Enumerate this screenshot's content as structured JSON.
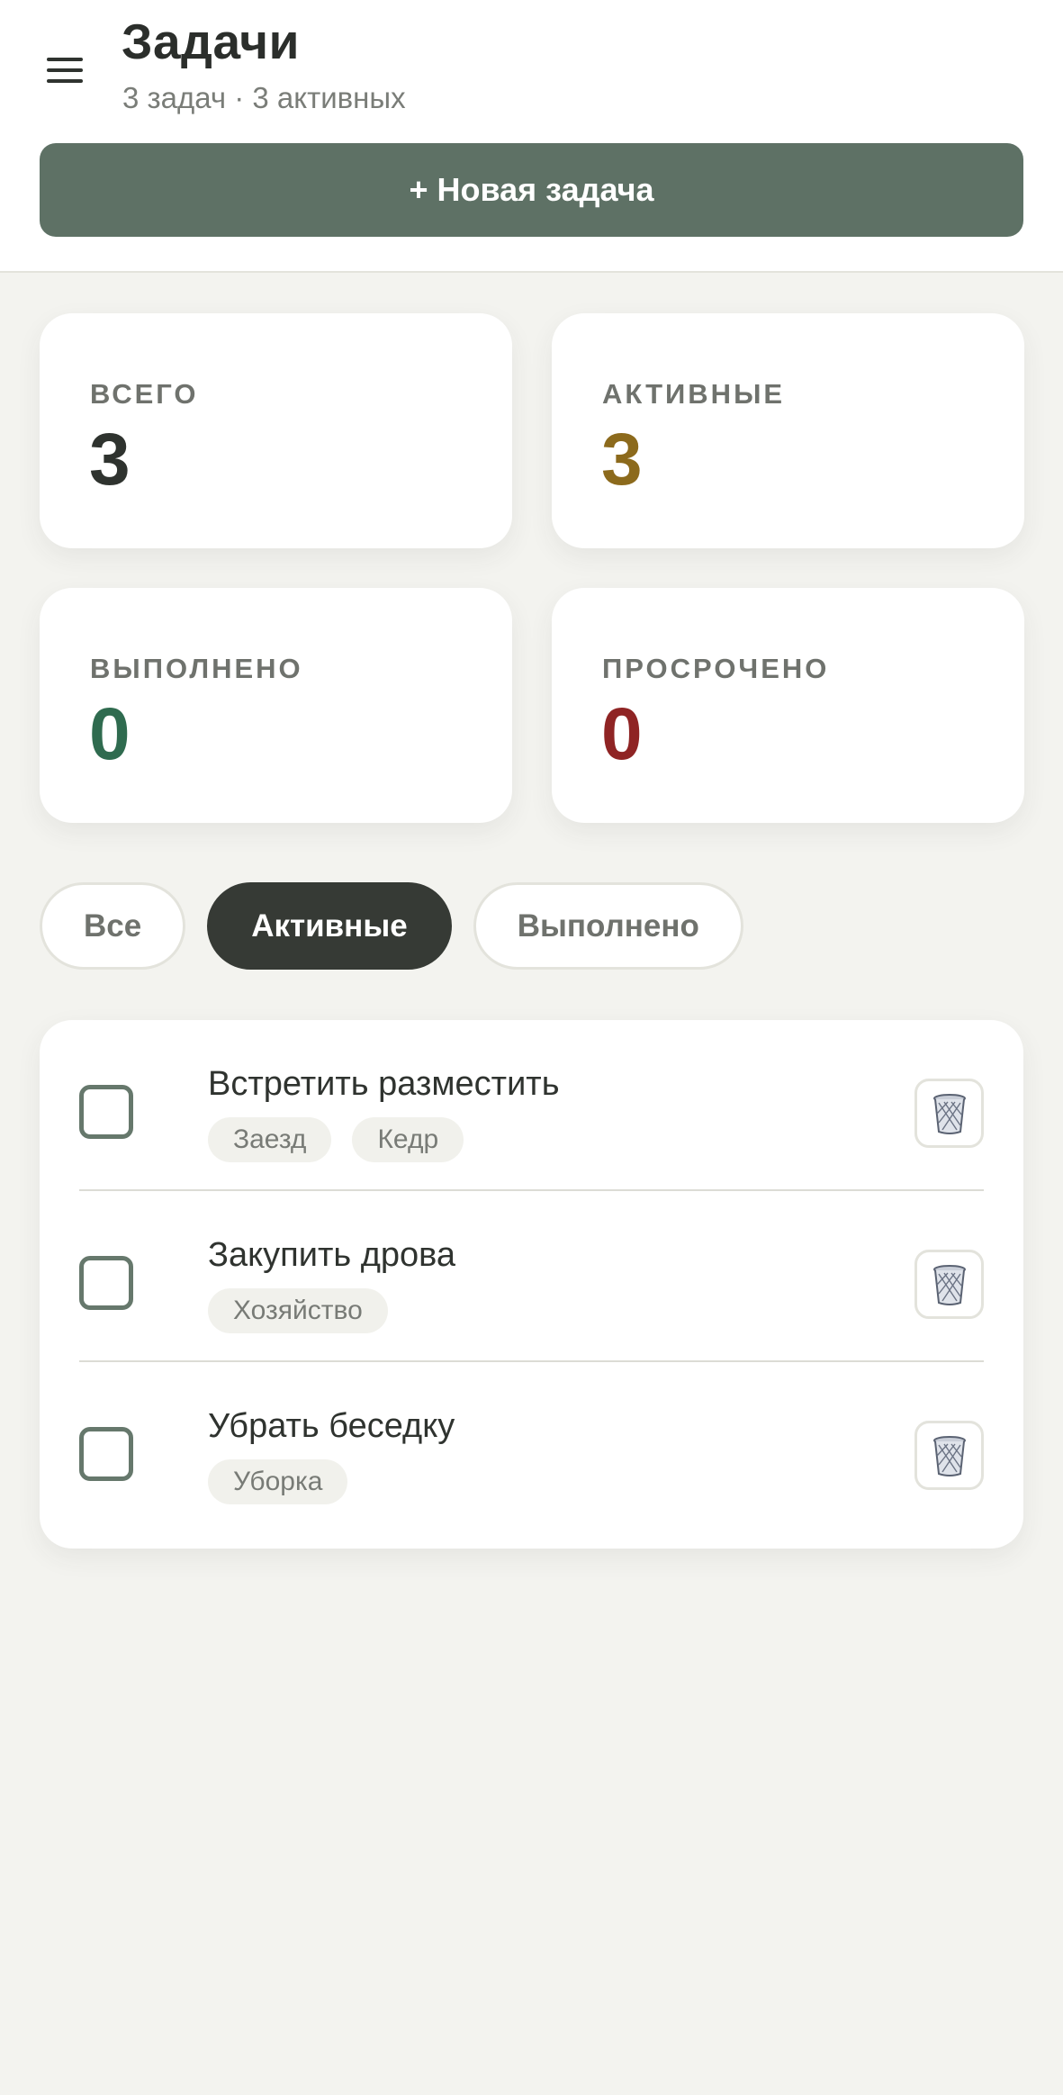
{
  "header": {
    "title": "Задачи",
    "subtitle": "3 задач · 3 активных",
    "new_task_label": "+ Новая задача"
  },
  "stats": {
    "total": {
      "label": "ВСЕГО",
      "value": "3",
      "color": "#2f332f"
    },
    "active": {
      "label": "АКТИВНЫЕ",
      "value": "3",
      "color": "#8c6a1c"
    },
    "done": {
      "label": "ВЫПОЛНЕНО",
      "value": "0",
      "color": "#2f6b4f"
    },
    "overdue": {
      "label": "ПРОСРОЧЕНО",
      "value": "0",
      "color": "#8f2424"
    }
  },
  "filters": [
    {
      "label": "Все",
      "active": false
    },
    {
      "label": "Активные",
      "active": true
    },
    {
      "label": "Выполнено",
      "active": false
    }
  ],
  "tasks": [
    {
      "title": "Встретить разместить",
      "done": false,
      "tags": [
        "Заезд",
        "Кедр"
      ]
    },
    {
      "title": "Закупить дрова",
      "done": false,
      "tags": [
        "Хозяйство"
      ]
    },
    {
      "title": "Убрать беседку",
      "done": false,
      "tags": [
        "Уборка"
      ]
    }
  ],
  "icons": {
    "menu": "hamburger-icon",
    "delete": "trash-icon"
  },
  "colors": {
    "accent": "#5e7165",
    "filter_active_bg": "#363a35",
    "page_bg": "#f3f3ef"
  }
}
